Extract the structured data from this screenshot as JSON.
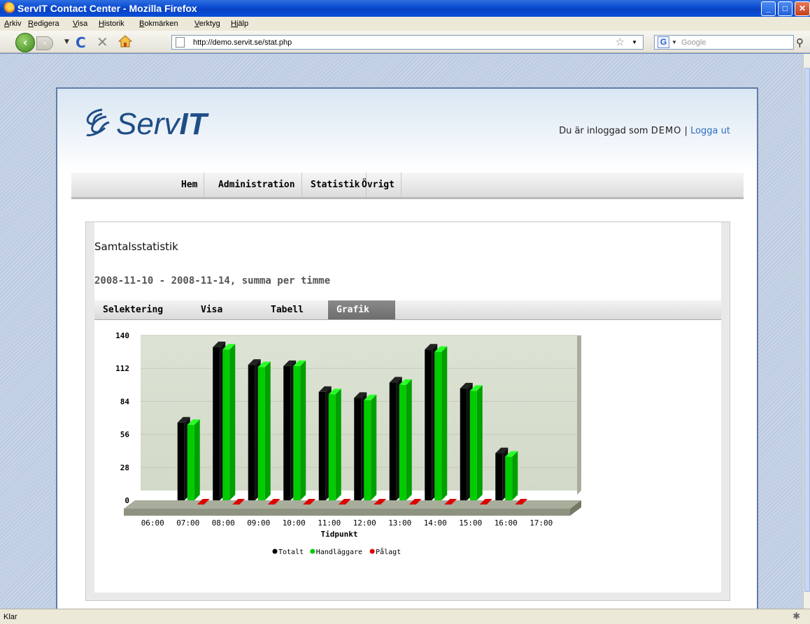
{
  "window": {
    "title": "ServIT Contact Center - Mozilla Firefox",
    "minimize": "_",
    "maximize": "□",
    "close": "✕"
  },
  "menubar": [
    "Arkiv",
    "Redigera",
    "Visa",
    "Historik",
    "Bokmärken",
    "Verktyg",
    "Hjälp"
  ],
  "navbar": {
    "back": "‹",
    "forward": "›",
    "reload": "C",
    "stop": "✕",
    "url": "http://demo.servit.se/stat.php",
    "search_placeholder": "Google",
    "icons": [
      "back-icon",
      "forward-icon",
      "reload-icon",
      "stop-icon",
      "home-icon",
      "page-icon",
      "star-icon",
      "google-icon",
      "search-icon"
    ]
  },
  "status": {
    "text": "Klar"
  },
  "site": {
    "logo": {
      "prefix": "Serv",
      "suffix": "IT"
    },
    "login": {
      "prefix": "Du är inloggad som",
      "user": "DEMO",
      "separator": "|",
      "logout": "Logga ut"
    },
    "menu": [
      "Hem",
      "Administration",
      "Statistik",
      "Övrigt"
    ]
  },
  "panel": {
    "title": "Samtalsstatistik",
    "subtitle": "2008-11-10 - 2008-11-14, summa per timme",
    "tabs": [
      "Selektering",
      "Visa",
      "Tabell",
      "Grafik"
    ],
    "active_tab": "Grafik"
  },
  "chart_data": {
    "type": "bar",
    "categories": [
      "06:00",
      "07:00",
      "08:00",
      "09:00",
      "10:00",
      "11:00",
      "12:00",
      "13:00",
      "14:00",
      "15:00",
      "16:00",
      "17:00"
    ],
    "series": [
      {
        "name": "Totalt",
        "color": "#000000",
        "values": [
          0,
          66,
          130,
          115,
          114,
          92,
          87,
          100,
          128,
          95,
          40,
          0
        ]
      },
      {
        "name": "Handläggare",
        "color": "#00cc00",
        "values": [
          0,
          64,
          128,
          113,
          114,
          90,
          85,
          98,
          126,
          93,
          37,
          0
        ]
      },
      {
        "name": "Pålagt",
        "color": "#dd0000",
        "values": [
          0,
          0,
          0,
          0,
          0,
          0,
          0,
          0,
          0,
          0,
          0,
          0
        ]
      }
    ],
    "xlabel": "Tidpunkt",
    "ylabel": "",
    "yticks": [
      0,
      28,
      56,
      84,
      112,
      140
    ],
    "ylim": [
      0,
      140
    ],
    "grid": true,
    "legend": "bottom-center"
  }
}
